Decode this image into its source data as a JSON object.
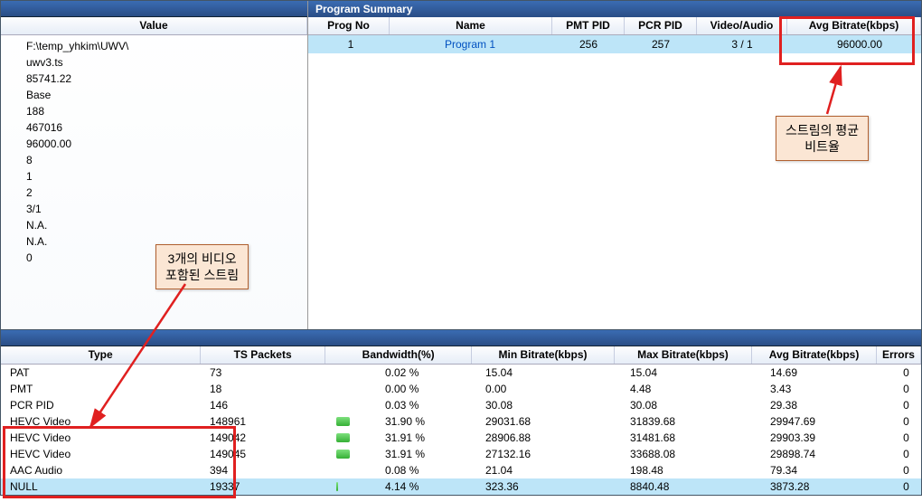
{
  "value_header": "Value",
  "value_list": [
    "F:\\temp_yhkim\\UWV\\",
    "uwv3.ts",
    "85741.22",
    "Base",
    "188",
    "467016",
    "96000.00",
    "8",
    "1",
    "2",
    "3/1",
    "N.A.",
    "N.A.",
    "0"
  ],
  "program_summary": {
    "title": "Program Summary",
    "cols": {
      "progno": "Prog No",
      "name": "Name",
      "pmt": "PMT PID",
      "pcr": "PCR PID",
      "va": "Video/Audio",
      "avg": "Avg Bitrate(kbps)"
    },
    "row": {
      "progno": "1",
      "name": "Program 1",
      "pmt": "256",
      "pcr": "257",
      "va": "3 / 1",
      "avg": "96000.00"
    }
  },
  "bottom": {
    "cols": {
      "type": "Type",
      "pkts": "TS Packets",
      "bw": "Bandwidth(%)",
      "min": "Min Bitrate(kbps)",
      "max": "Max Bitrate(kbps)",
      "avgb": "Avg Bitrate(kbps)",
      "err": "Errors"
    },
    "rows": [
      {
        "type": "PAT",
        "pkts": "73",
        "bw_pct": 0.02,
        "bw": "0.02 %",
        "min": "15.04",
        "max": "15.04",
        "avgb": "14.69",
        "err": "0"
      },
      {
        "type": "PMT",
        "pkts": "18",
        "bw_pct": 0.0,
        "bw": "0.00 %",
        "min": "0.00",
        "max": "4.48",
        "avgb": "3.43",
        "err": "0"
      },
      {
        "type": "PCR PID",
        "pkts": "146",
        "bw_pct": 0.03,
        "bw": "0.03 %",
        "min": "30.08",
        "max": "30.08",
        "avgb": "29.38",
        "err": "0"
      },
      {
        "type": "HEVC Video",
        "pkts": "148961",
        "bw_pct": 31.9,
        "bw": "31.90 %",
        "min": "29031.68",
        "max": "31839.68",
        "avgb": "29947.69",
        "err": "0"
      },
      {
        "type": "HEVC Video",
        "pkts": "149042",
        "bw_pct": 31.91,
        "bw": "31.91 %",
        "min": "28906.88",
        "max": "31481.68",
        "avgb": "29903.39",
        "err": "0"
      },
      {
        "type": "HEVC Video",
        "pkts": "149045",
        "bw_pct": 31.91,
        "bw": "31.91 %",
        "min": "27132.16",
        "max": "33688.08",
        "avgb": "29898.74",
        "err": "0"
      },
      {
        "type": "AAC Audio",
        "pkts": "394",
        "bw_pct": 0.08,
        "bw": "0.08 %",
        "min": "21.04",
        "max": "198.48",
        "avgb": "79.34",
        "err": "0"
      },
      {
        "type": "NULL",
        "pkts": "19337",
        "bw_pct": 4.14,
        "bw": "4.14 %",
        "min": "323.36",
        "max": "8840.48",
        "avgb": "3873.28",
        "err": "0",
        "sel": true
      }
    ]
  },
  "callouts": {
    "left": "3개의 비디오\n포함된 스트림",
    "right": "스트림의 평균\n비트율"
  }
}
